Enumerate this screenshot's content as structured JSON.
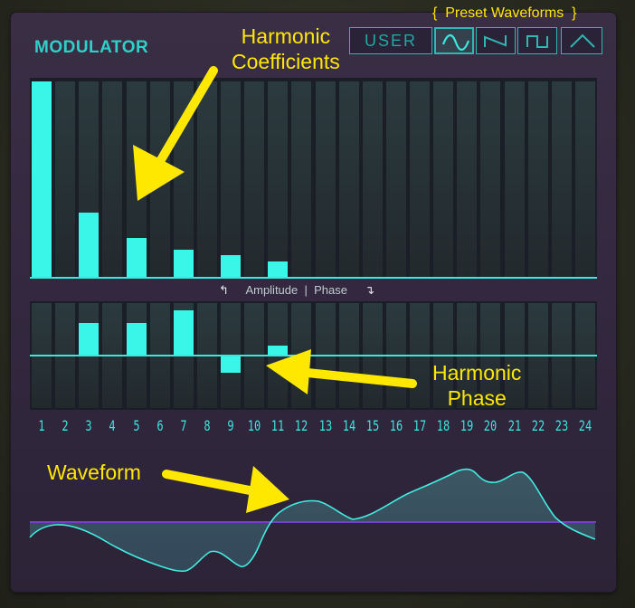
{
  "modulator": {
    "title": "MODULATOR",
    "preset_waveforms_label": "{  Preset Waveforms  }",
    "buttons": [
      {
        "label": "USER",
        "icon": null,
        "selected": false
      },
      {
        "label": "",
        "icon": "sine-wave-icon",
        "selected": true
      },
      {
        "label": "",
        "icon": "sawtooth-wave-icon",
        "selected": false
      },
      {
        "label": "",
        "icon": "square-wave-icon",
        "selected": false
      },
      {
        "label": "",
        "icon": "triangle-wave-icon",
        "selected": false
      }
    ],
    "amplitude_phase": {
      "left_arrow": "↰",
      "text": "Amplitude  |  Phase",
      "right_arrow": "↴"
    },
    "harmonic_numbers": [
      "1",
      "2",
      "3",
      "4",
      "5",
      "6",
      "7",
      "8",
      "9",
      "10",
      "11",
      "12",
      "13",
      "14",
      "15",
      "16",
      "17",
      "18",
      "19",
      "20",
      "21",
      "22",
      "23",
      "24"
    ],
    "amplitudes": [
      1.0,
      0,
      0.33,
      0,
      0.2,
      0,
      0.14,
      0,
      0.11,
      0,
      0.08,
      0,
      0,
      0,
      0,
      0,
      0,
      0,
      0,
      0,
      0,
      0,
      0,
      0
    ],
    "phases": [
      0,
      0,
      0.62,
      0,
      0.62,
      0,
      0.88,
      0,
      -0.34,
      0,
      0.18,
      0,
      0,
      0,
      0,
      0,
      0,
      0,
      0,
      0,
      0,
      0,
      0,
      0
    ]
  },
  "annotations": {
    "coefficients": [
      "Harmonic",
      "Coefficients"
    ],
    "phase": [
      "Harmonic",
      "Phase"
    ],
    "waveform": "Waveform"
  },
  "colors": {
    "accent": "#3af6e8",
    "annotation": "#ffe800",
    "waveform_line": "#7a3fc0"
  }
}
